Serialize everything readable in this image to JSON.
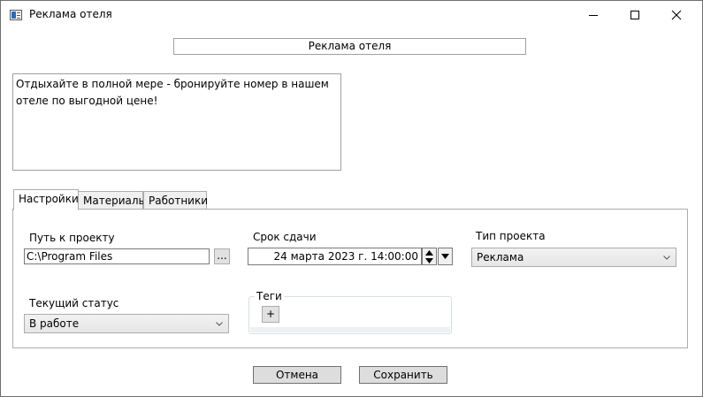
{
  "window": {
    "title": "Реклама отеля"
  },
  "project": {
    "name": "Реклама отеля",
    "description": "Отдыхайте в полной мере - бронируйте номер в нашем отеле по выгодной цене!"
  },
  "tabs": [
    {
      "label": "Настройки",
      "active": true
    },
    {
      "label": "Материалы",
      "active": false
    },
    {
      "label": "Работники",
      "active": false
    }
  ],
  "settings": {
    "path_label": "Путь к проекту",
    "path_value": "C:\\Program Files",
    "browse_label": "...",
    "deadline_label": "Срок сдачи",
    "deadline_value": "24 марта 2023 г. 14:00:00",
    "type_label": "Тип проекта",
    "type_value": "Реклама",
    "status_label": "Текущий статус",
    "status_value": "В работе",
    "tags_label": "Теги",
    "add_tag_label": "+"
  },
  "footer": {
    "cancel_label": "Отмена",
    "save_label": "Сохранить"
  }
}
